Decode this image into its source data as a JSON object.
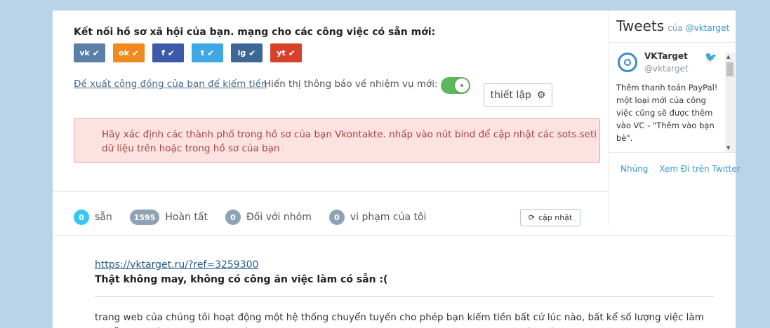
{
  "connect": {
    "title": "Kết nối hồ sơ xã hội của bạn. mạng cho các công việc có sẵn mới:",
    "networks": [
      {
        "label": "vk",
        "color": "#5b7fa6",
        "icon": "vk-icon"
      },
      {
        "label": "ok",
        "color": "#ef8a1e",
        "icon": "odnoklassniki-icon"
      },
      {
        "label": "f",
        "color": "#3b5ba8",
        "icon": "facebook-icon"
      },
      {
        "label": "t",
        "color": "#3ea8e6",
        "icon": "twitter-icon"
      },
      {
        "label": "ig",
        "color": "#3d6896",
        "icon": "instagram-icon"
      },
      {
        "label": "yt",
        "color": "#d9402b",
        "icon": "youtube-icon"
      }
    ]
  },
  "community_link": "Đề xuất cộng đồng của bạn để kiếm tiền",
  "notify_label": "Hiển thị thông báo về nhiệm vụ mới:",
  "notify_on": true,
  "setup_label": "thiết lập",
  "alert_text": "Hãy xác định các thành phố trong hồ sơ của bạn Vkontakte. nhấp vào nút bind để cập nhật các sots.seti dữ liệu trên hoặc trong hồ sơ của bạn",
  "stats": [
    {
      "count": "0",
      "label": "sẵn",
      "color": "#36c6f4"
    },
    {
      "count": "1595",
      "label": "Hoàn tất",
      "color": "#8ea2b5"
    },
    {
      "count": "0",
      "label": "Đối với nhóm",
      "color": "#8ea2b5"
    },
    {
      "count": "0",
      "label": "vi phạm của tôi",
      "color": "#8ea2b5"
    }
  ],
  "refresh_label": "cập nhật",
  "ref_link": "https://vktarget.ru/?ref=3259300",
  "sorry_text": "Thật không may, không có công ăn việc làm có sẵn :(",
  "description": "trang web của chúng tôi hoạt động một hệ thống chuyển tuyến cho phép bạn kiếm tiền bất cứ lúc nào, bất kể số lượng việc làm có sẵn. Chỉ cần sao chép liên kết của bạn, gửi nó cho bạn bè, trên trang mạng xã hội và kiếm tiền.",
  "tweets": {
    "title": "Tweets",
    "by": "của",
    "handle_link": "@vktarget",
    "name": "VKTarget",
    "handle": "@vktarget",
    "text": "Thêm thanh toán PayPal! một loại mới của công việc cũng sẽ được thêm vào VC - \"Thêm vào bạn bè\".",
    "embed": "Nhúng",
    "view": "Xem Đi trên Twitter"
  }
}
